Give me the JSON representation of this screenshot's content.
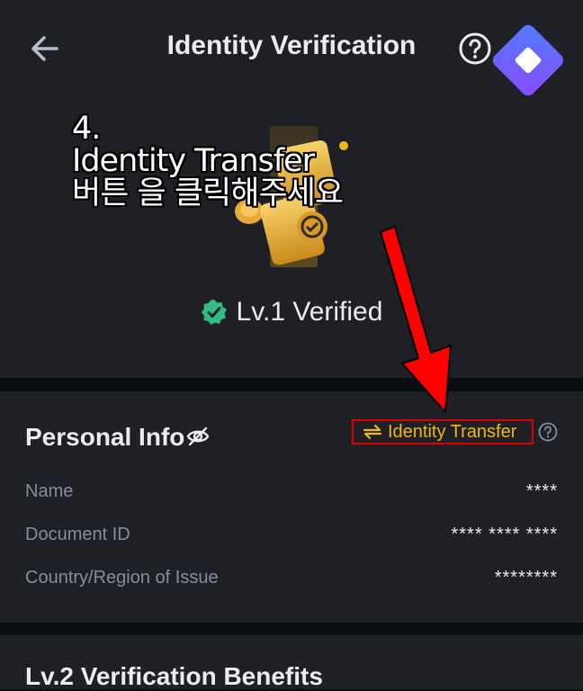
{
  "header": {
    "title": "Identity Verification"
  },
  "annotation": {
    "line1": "4.",
    "line2": "Identity Transfer",
    "line3": "버튼 을 클릭해주세요"
  },
  "status": {
    "label": "Lv.1 Verified"
  },
  "personal_info": {
    "title": "Personal Info",
    "transfer_label": "Identity Transfer",
    "rows": [
      {
        "label": "Name",
        "value": "****"
      },
      {
        "label": "Document ID",
        "value": "**** **** ****"
      },
      {
        "label": "Country/Region of Issue",
        "value": "********"
      }
    ]
  },
  "next_section": {
    "title": "Lv.2 Verification Benefits"
  },
  "colors": {
    "accent": "#f0b90b",
    "verified": "#2ebd85",
    "highlight_box": "#e00000",
    "arrow": "#ff0000",
    "logo": "#6a5cff"
  }
}
